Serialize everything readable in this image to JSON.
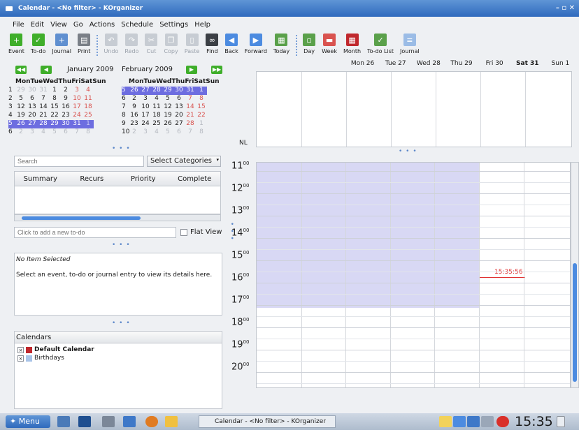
{
  "window": {
    "title": "Calendar - <No filter> - KOrganizer",
    "controls": "– ▫ ✕"
  },
  "menu": [
    "File",
    "Edit",
    "View",
    "Go",
    "Actions",
    "Schedule",
    "Settings",
    "Help"
  ],
  "toolbar": {
    "event": "Event",
    "todo": "To-do",
    "journal": "Journal",
    "print": "Print",
    "undo": "Undo",
    "redo": "Redo",
    "cut": "Cut",
    "copy": "Copy",
    "paste": "Paste",
    "find": "Find",
    "back": "Back",
    "forward": "Forward",
    "today": "Today",
    "day": "Day",
    "week": "Week",
    "month": "Month",
    "todolist": "To-do List",
    "journalview": "Journal"
  },
  "minical": {
    "month1": "January 2009",
    "month2": "February 2009",
    "dayheader": "MonTueWedThuFriSatSun",
    "jan": [
      [
        "1",
        "29",
        "30",
        "31",
        "1",
        "2",
        "3",
        "4"
      ],
      [
        "2",
        "5",
        "6",
        "7",
        "8",
        "9",
        "10",
        "11"
      ],
      [
        "3",
        "12",
        "13",
        "14",
        "15",
        "16",
        "17",
        "18"
      ],
      [
        "4",
        "19",
        "20",
        "21",
        "22",
        "23",
        "24",
        "25"
      ],
      [
        "5",
        "26",
        "27",
        "28",
        "29",
        "30",
        "31",
        "1"
      ],
      [
        "6",
        "2",
        "3",
        "4",
        "5",
        "6",
        "7",
        "8"
      ]
    ],
    "feb": [
      [
        "5",
        "26",
        "27",
        "28",
        "29",
        "30",
        "31",
        "1"
      ],
      [
        "6",
        "2",
        "3",
        "4",
        "5",
        "6",
        "7",
        "8"
      ],
      [
        "7",
        "9",
        "10",
        "11",
        "12",
        "13",
        "14",
        "15"
      ],
      [
        "8",
        "16",
        "17",
        "18",
        "19",
        "20",
        "21",
        "22"
      ],
      [
        "9",
        "23",
        "24",
        "25",
        "26",
        "27",
        "28",
        "1"
      ],
      [
        "10",
        "2",
        "3",
        "4",
        "5",
        "6",
        "7",
        "8"
      ]
    ]
  },
  "search": {
    "placeholder": "Search",
    "categories": "Select Categories"
  },
  "todo": {
    "cols": [
      "Summary",
      "Recurs",
      "Priority",
      "Complete"
    ],
    "add": "Click to add a new to-do",
    "flat": "Flat View"
  },
  "details": {
    "title": "No Item Selected",
    "text": "Select an event, to-do or journal entry to view its details here."
  },
  "calendars": {
    "title": "Calendars",
    "items": [
      "Default Calendar",
      "Birthdays"
    ],
    "colors": [
      "#c0282d",
      "#a9c4e8"
    ]
  },
  "week": {
    "days": [
      "Mon 26",
      "Tue 27",
      "Wed 28",
      "Thu 29",
      "Fri 30",
      "Sat 31",
      "Sun 1"
    ],
    "nl": "NL",
    "hours": [
      "11",
      "12",
      "13",
      "14",
      "15",
      "16",
      "17",
      "18",
      "19",
      "20"
    ],
    "now": "15:35:56"
  },
  "taskbar": {
    "menu": "Menu",
    "task": "Calendar - <No filter> - KOrganizer",
    "clock": "15:35"
  }
}
